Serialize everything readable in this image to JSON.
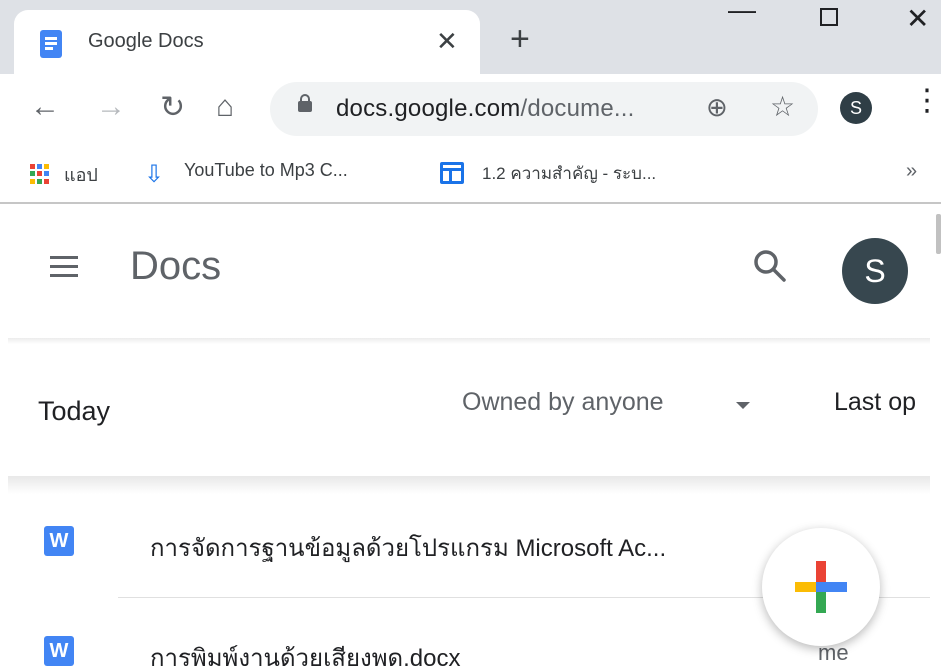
{
  "browser": {
    "tab": {
      "title": "Google Docs",
      "close_glyph": "✕"
    },
    "new_tab_glyph": "+",
    "url": {
      "host": "docs.google.com",
      "path": "/docume..."
    },
    "profile_initial": "S",
    "bookmarks": [
      {
        "label": "แอป",
        "icon": "apps-grid-icon"
      },
      {
        "label": "YouTube to Mp3 C...",
        "icon": "cloud-download-icon"
      },
      {
        "label": "1.2 ความสำคัญ - ระบ...",
        "icon": "sites-icon"
      }
    ],
    "bookmarks_more": "»"
  },
  "docs": {
    "app_title": "Docs",
    "user_initial": "S",
    "section_title": "Today",
    "owner_filter": "Owned by anyone",
    "sort_label": "Last op",
    "files": [
      {
        "name": "การจัดการฐานข้อมูลด้วยโปรแกรม Microsoft Ac...",
        "owner": "",
        "type_icon": "W"
      },
      {
        "name": "การพิมพ์งานด้วยเสียงพูด.docx",
        "owner": "me",
        "type_icon": "W"
      }
    ]
  },
  "colors": {
    "tabstrip": "#dee1e6",
    "accent_blue": "#4285f4",
    "avatar": "#37474f",
    "plus_red": "#ea4335",
    "plus_blue": "#4285f4",
    "plus_yellow": "#fbbc04",
    "plus_green": "#34a853"
  }
}
